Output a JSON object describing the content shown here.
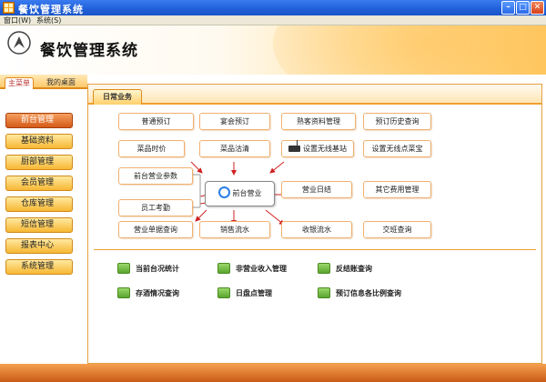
{
  "window": {
    "title": "餐饮管理系统",
    "min": "–",
    "max": "□",
    "close": "✕"
  },
  "menu": {
    "items": [
      "窗口(W)",
      "系统(S)"
    ]
  },
  "header": {
    "title": "餐饮管理系统"
  },
  "left": {
    "tabs": [
      "主菜单",
      "我的桌面"
    ],
    "nav": [
      "前台管理",
      "基础资料",
      "厨部管理",
      "会员管理",
      "仓库管理",
      "短信管理",
      "报表中心",
      "系统管理"
    ]
  },
  "main": {
    "tab": "日常业务",
    "flow": {
      "row1": [
        "普通预订",
        "宴会预订",
        "熟客资料管理",
        "预订历史查询"
      ],
      "row2": [
        "菜品时价",
        "菜品沽清",
        "设置无线基站",
        "设置无线点菜宝"
      ],
      "left": [
        "前台营业参数",
        "员工考勤"
      ],
      "center": "前台营业",
      "right": [
        "营业日结",
        "其它费用管理"
      ],
      "bottom": [
        "营业单据查询",
        "销售流水",
        "收银流水",
        "交班查询"
      ]
    },
    "quick": [
      "当前台况统计",
      "非营业收入管理",
      "反结账查询",
      "存酒情况查询",
      "日盘点管理",
      "预订信息各比例查询"
    ]
  }
}
